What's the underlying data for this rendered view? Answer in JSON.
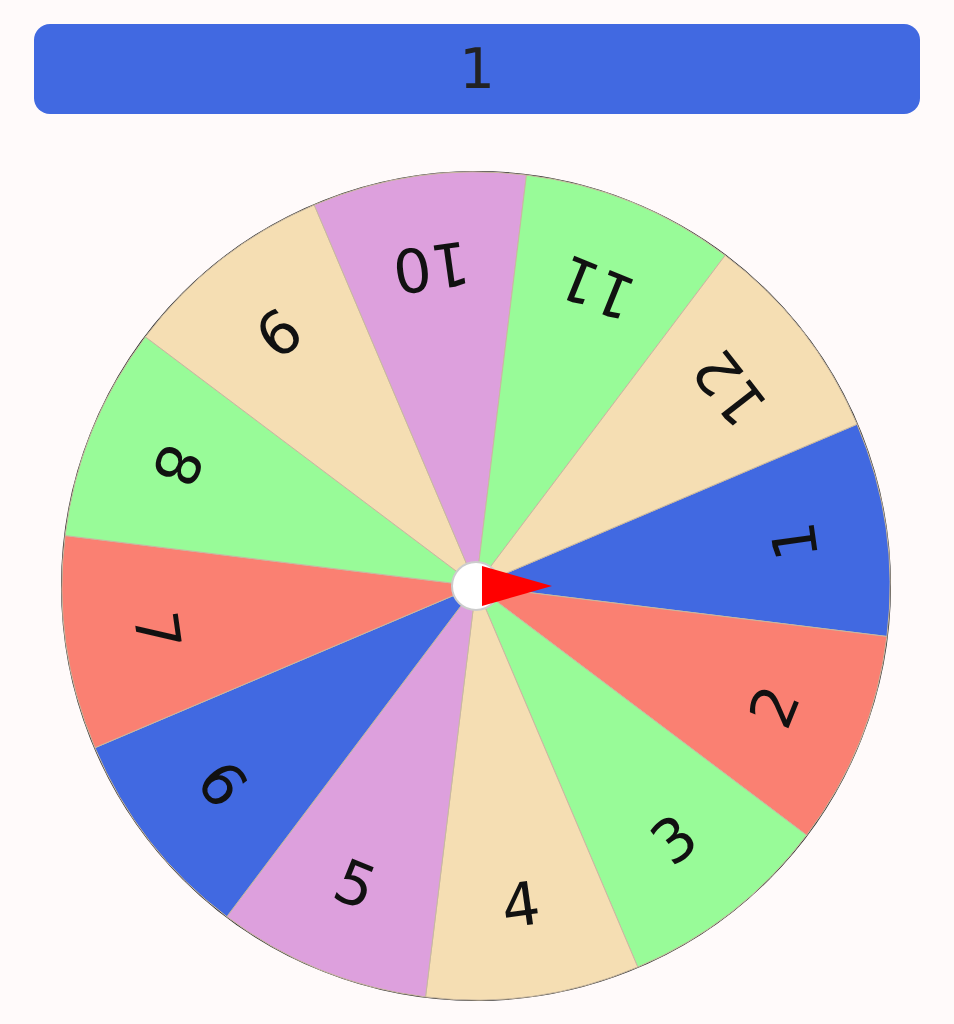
{
  "result": {
    "label": "1"
  },
  "wheel": {
    "slices": [
      {
        "label": "1",
        "color": "#4169e1"
      },
      {
        "label": "2",
        "color": "#fa8072"
      },
      {
        "label": "3",
        "color": "#98fb98"
      },
      {
        "label": "4",
        "color": "#f5deb3"
      },
      {
        "label": "5",
        "color": "#dda0dd"
      },
      {
        "label": "6",
        "color": "#4169e1"
      },
      {
        "label": "7",
        "color": "#fa8072"
      },
      {
        "label": "8",
        "color": "#98fb98"
      },
      {
        "label": "9",
        "color": "#f5deb3"
      },
      {
        "label": "10",
        "color": "#dda0dd"
      },
      {
        "label": "11",
        "color": "#98fb98"
      },
      {
        "label": "12",
        "color": "#f5deb3"
      }
    ]
  }
}
